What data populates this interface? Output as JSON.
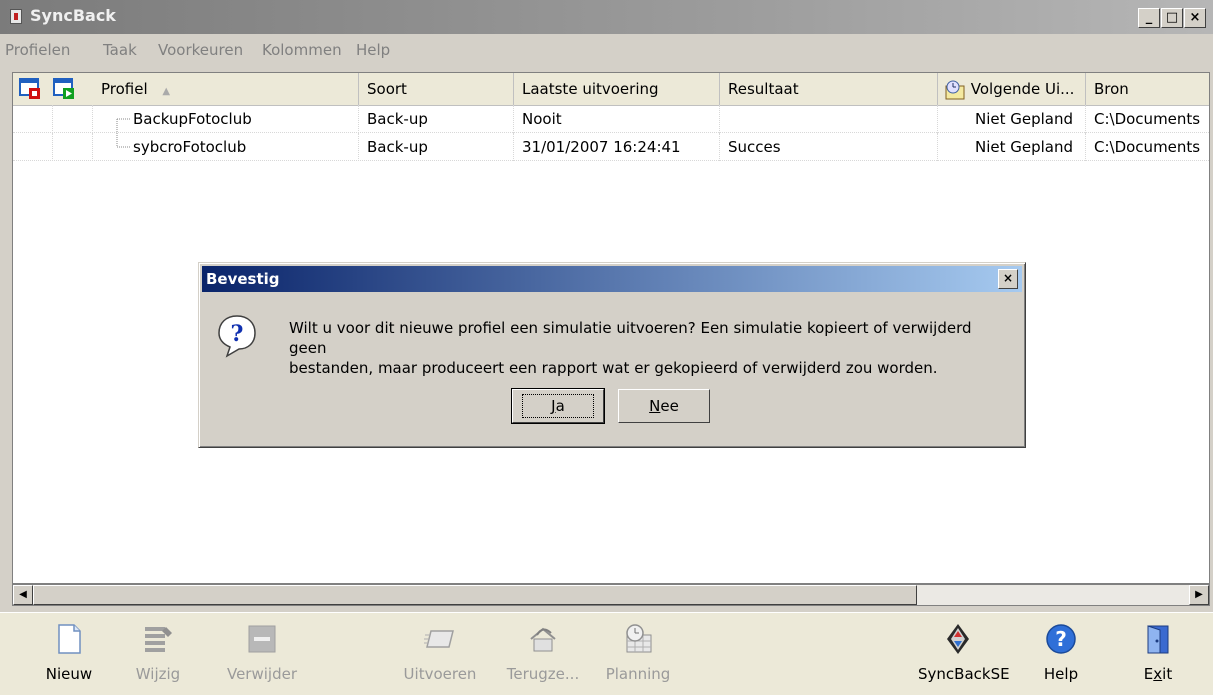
{
  "window": {
    "title": "SyncBack",
    "minimize_label": "_",
    "maximize_label": "□",
    "close_label": "×"
  },
  "menu": [
    "Profielen",
    "Taak",
    "Voorkeuren",
    "Kolommen",
    "Help"
  ],
  "columns": {
    "profile": "Profiel",
    "type": "Soort",
    "last_run": "Laatste uitvoering",
    "result": "Resultaat",
    "next_run": "Volgende Ui...",
    "source": "Bron",
    "sort_indicator": "▲"
  },
  "rows": [
    {
      "name": "BackupFotoclub",
      "type": "Back-up",
      "last_run": "Nooit",
      "result": "",
      "next_run": "Niet Gepland",
      "source": "C:\\Documents"
    },
    {
      "name": "sybcroFotoclub",
      "type": "Back-up",
      "last_run": "31/01/2007 16:24:41",
      "result": "Succes",
      "next_run": "Niet Gepland",
      "source": "C:\\Documents"
    }
  ],
  "scroll": {
    "left_arrow": "◀",
    "right_arrow": "▶"
  },
  "toolbar": {
    "new": "Nieuw",
    "edit": "Wijzig",
    "delete": "Verwijder",
    "run": "Uitvoeren",
    "restore": "Terugze...",
    "schedule": "Planning",
    "syncbackse": "SyncBackSE",
    "help": "Help",
    "exit_pre": "E",
    "exit_u": "x",
    "exit_post": "it"
  },
  "dialog": {
    "title": "Bevestig",
    "close_label": "×",
    "message_line1": "Wilt u voor dit nieuwe profiel een simulatie uitvoeren? Een simulatie kopieert of verwijderd geen",
    "message_line2": "bestanden, maar produceert een rapport wat er gekopieerd of verwijderd zou worden.",
    "yes_u": "J",
    "yes_rest": "a",
    "no_u": "N",
    "no_rest": "ee",
    "icon_glyph": "?"
  },
  "colors": {
    "dialog_title_start": "#0a246a",
    "dialog_title_end": "#a6caf0",
    "window_face": "#d4d0c8"
  }
}
